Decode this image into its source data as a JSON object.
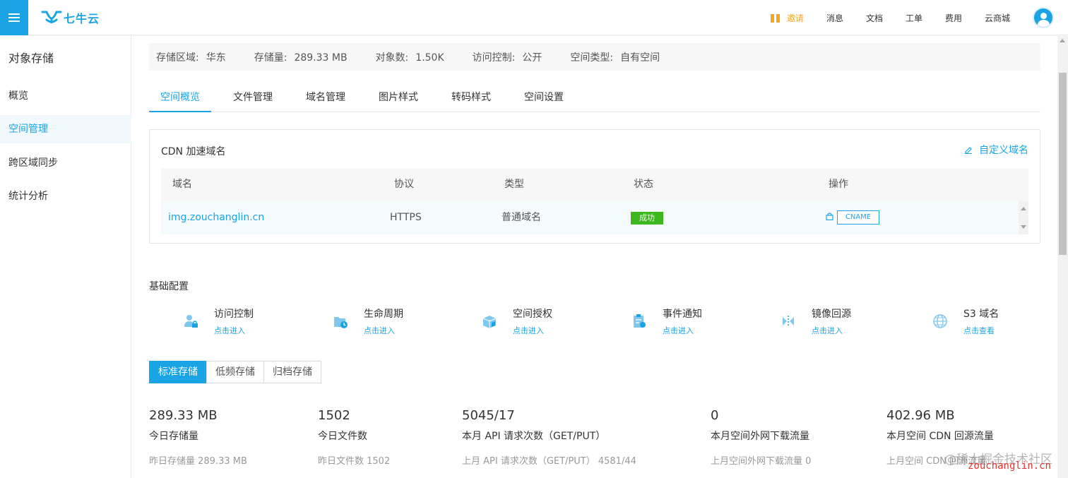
{
  "topbar": {
    "logo_text": "七牛云",
    "nav": {
      "invite": "邀请",
      "messages": "消息",
      "docs": "文档",
      "tickets": "工单",
      "billing": "费用",
      "marketplace": "云商城"
    }
  },
  "sidebar": {
    "title": "对象存储",
    "items": [
      {
        "label": "概览"
      },
      {
        "label": "空间管理"
      },
      {
        "label": "跨区域同步"
      },
      {
        "label": "统计分析"
      }
    ]
  },
  "info": {
    "region_label": "存储区域:",
    "region_value": "华东",
    "usage_label": "存储量:",
    "usage_value": "289.33 MB",
    "objects_label": "对象数:",
    "objects_value": "1.50K",
    "access_label": "访问控制:",
    "access_value": "公开",
    "type_label": "空间类型:",
    "type_value": "自有空间"
  },
  "tabs": [
    "空间概览",
    "文件管理",
    "域名管理",
    "图片样式",
    "转码样式",
    "空间设置"
  ],
  "cdn": {
    "title": "CDN 加速域名",
    "custom_domain": "自定义域名",
    "headers": [
      "域名",
      "协议",
      "类型",
      "状态",
      "操作"
    ],
    "row": {
      "domain": "img.zouchanglin.cn",
      "protocol": "HTTPS",
      "type": "普通域名",
      "status": "成功",
      "action": "CNAME"
    }
  },
  "basic_config": {
    "title": "基础配置",
    "items": [
      {
        "name": "访问控制",
        "action": "点击进入",
        "icon": "user-lock-icon"
      },
      {
        "name": "生命周期",
        "action": "点击进入",
        "icon": "lifecycle-icon"
      },
      {
        "name": "空间授权",
        "action": "点击进入",
        "icon": "bucket-auth-icon"
      },
      {
        "name": "事件通知",
        "action": "点击进入",
        "icon": "event-notify-icon"
      },
      {
        "name": "镜像回源",
        "action": "点击进入",
        "icon": "mirror-icon"
      },
      {
        "name": "S3 域名",
        "action": "点击查看",
        "icon": "globe-icon"
      }
    ]
  },
  "storage_tabs": [
    "标准存储",
    "低频存储",
    "归档存储"
  ],
  "stats": [
    {
      "value": "289.33 MB",
      "label": "今日存储量",
      "prev": "昨日存储量 289.33 MB"
    },
    {
      "value": "1502",
      "label": "今日文件数",
      "prev": "昨日文件数 1502"
    },
    {
      "value": "5045/17",
      "label": "本月 API 请求次数（GET/PUT）",
      "prev": "上月 API 请求次数（GET/PUT） 4581/44"
    },
    {
      "value": "0",
      "label": "本月空间外网下载流量",
      "prev": "上月空间外网下载流量 0"
    },
    {
      "value": "402.96 MB",
      "label": "本月空间 CDN 回源流量",
      "prev": "上月空间 CDN 回源流量"
    }
  ],
  "watermark": {
    "line1": "@稀土掘金技术社区",
    "line2": "zouchanglin.cn"
  },
  "colors": {
    "accent": "#1aa4e6",
    "success": "#3cb81e",
    "invite": "#f5a623"
  }
}
